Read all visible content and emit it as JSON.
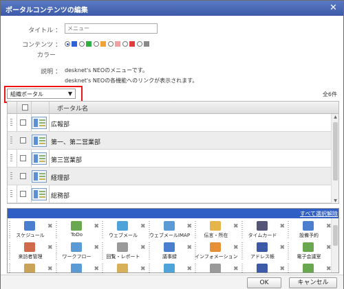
{
  "dialog": {
    "title": "ポータルコンテンツの編集",
    "close_glyph": "✕"
  },
  "form": {
    "title_label": "タイトル ：",
    "title_placeholder": "メニュー",
    "color_label_line1": "コンテンツ ：",
    "color_label_line2": "カラー",
    "colors": [
      "#2e62d6",
      "#ffffff",
      "#2fae42",
      "#ffffff",
      "#f2a233",
      "#ffffff",
      "#f0a0a0",
      "#ffffff",
      "#e23b3b",
      "#ffffff",
      "#888888"
    ],
    "selected_color": "#2e62d6",
    "desc_label": "説明 ：",
    "desc_line1": "desknet's NEOのメニューです。",
    "desc_line2": "desknet's NEOの各機能へのリンクが表示されます。"
  },
  "portal_select": {
    "value": "組織ポータル",
    "arrow": "▼"
  },
  "count_text": "全6件",
  "table": {
    "header_name": "ポータル名",
    "rows": [
      {
        "name": "広報部"
      },
      {
        "name": "第一、第二営業部"
      },
      {
        "name": "第三営業部"
      },
      {
        "name": "経理部"
      },
      {
        "name": "総務部"
      }
    ]
  },
  "menu": {
    "clear_all": "すべて選択解除",
    "remove_glyph": "✖",
    "items": [
      {
        "label": "スケジュール",
        "icon": "calendar-icon",
        "color": "#4a7fd0"
      },
      {
        "label": "ToDo",
        "icon": "todo-icon",
        "color": "#6aa84f"
      },
      {
        "label": "ウェブメール",
        "icon": "webmail-icon",
        "color": "#4ea3d8"
      },
      {
        "label": "ウェブメールIMAP",
        "icon": "webmail-imap-icon",
        "color": "#5a9bd5"
      },
      {
        "label": "伝言・所在",
        "icon": "message-icon",
        "color": "#e6b54a"
      },
      {
        "label": "タイムカード",
        "icon": "timecard-icon",
        "color": "#555577"
      },
      {
        "label": "設備予約",
        "icon": "facility-icon",
        "color": "#4a7fd0"
      },
      {
        "label": "来訪者管理",
        "icon": "visitor-icon",
        "color": "#d06a4a"
      },
      {
        "label": "ワークフロー",
        "icon": "workflow-icon",
        "color": "#5a9bd5"
      },
      {
        "label": "回覧・レポート",
        "icon": "circular-icon",
        "color": "#999999"
      },
      {
        "label": "議事録",
        "icon": "minutes-icon",
        "color": "#4a7fd0"
      },
      {
        "label": "インフォメーション",
        "icon": "information-icon",
        "color": "#e69138"
      },
      {
        "label": "アドレス帳",
        "icon": "address-book-icon",
        "color": "#3d5aa8"
      },
      {
        "label": "電子会議室",
        "icon": "conference-icon",
        "color": "#6aa84f"
      },
      {
        "label": "",
        "icon": "cabinet-icon",
        "color": "#c9a35a"
      },
      {
        "label": "",
        "icon": "document-icon",
        "color": "#5a9bd5"
      },
      {
        "label": "",
        "icon": "folder-icon",
        "color": "#d6b15a"
      },
      {
        "label": "",
        "icon": "globe-icon",
        "color": "#4ea3d8"
      },
      {
        "label": "",
        "icon": "paper-icon",
        "color": "#999999"
      },
      {
        "label": "",
        "icon": "book-icon",
        "color": "#3d5aa8"
      },
      {
        "label": "",
        "icon": "chart-icon",
        "color": "#6aa84f"
      }
    ]
  },
  "footer": {
    "ok": "OK",
    "cancel": "キャンセル"
  }
}
